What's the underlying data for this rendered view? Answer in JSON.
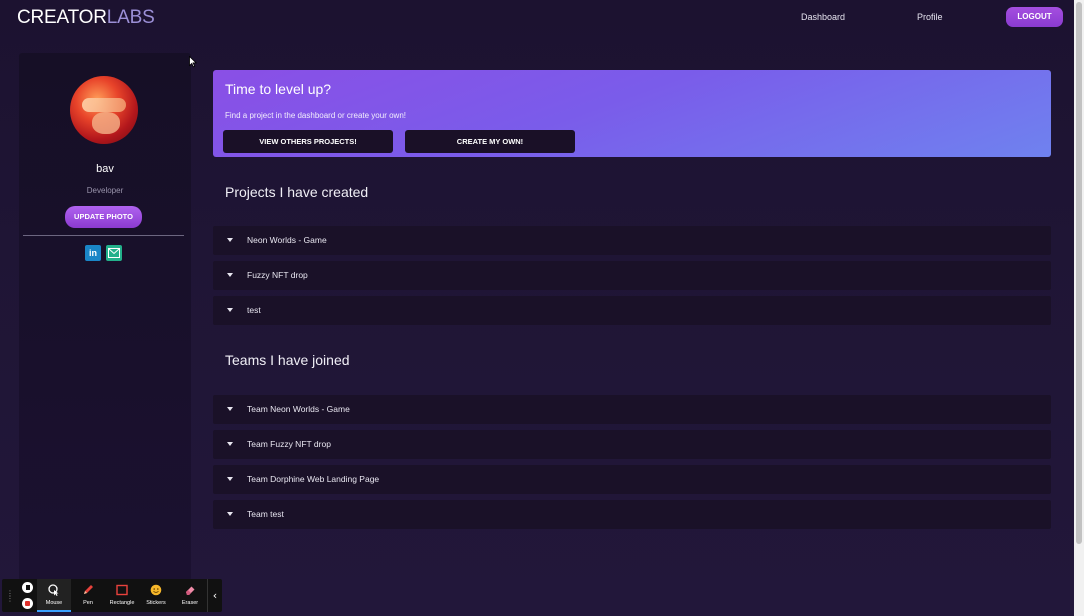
{
  "navbar": {
    "logo_part1": "CREATOR",
    "logo_part2": "LABS",
    "dashboard_label": "Dashboard",
    "profile_label": "Profile",
    "logout_label": "LOGOUT"
  },
  "sidebar": {
    "username": "bav",
    "role": "Developer",
    "update_photo_label": "UPDATE PHOTO",
    "linkedin_label": "in",
    "social_icons": [
      "linkedin-icon",
      "mail-icon"
    ]
  },
  "banner": {
    "title": "Time to level up?",
    "subtitle": "Find a project in the dashboard or create your own!",
    "view_label": "VIEW OTHERS PROJECTS!",
    "create_label": "CREATE MY OWN!"
  },
  "projects": {
    "title": "Projects I have created",
    "items": [
      "Neon Worlds - Game",
      "Fuzzy NFT drop",
      "test"
    ]
  },
  "teams": {
    "title": "Teams I have joined",
    "items": [
      "Team Neon Worlds - Game",
      "Team Fuzzy NFT drop",
      "Team Dorphine Web Landing Page",
      "Team test"
    ]
  },
  "toolbar": {
    "mouse_label": "Mouse",
    "pen_label": "Pen",
    "rectangle_label": "Rectangle",
    "stickers_label": "Stickers",
    "eraser_label": "Eraser",
    "active_tool": "Mouse"
  },
  "colors": {
    "background": "#1d1432",
    "accent_purple": "#9b4fe0",
    "logo_accent": "#9b8fd6",
    "banner_start": "#8a4fe6",
    "banner_end": "#6f82ef",
    "button_dark": "#1a1027"
  }
}
